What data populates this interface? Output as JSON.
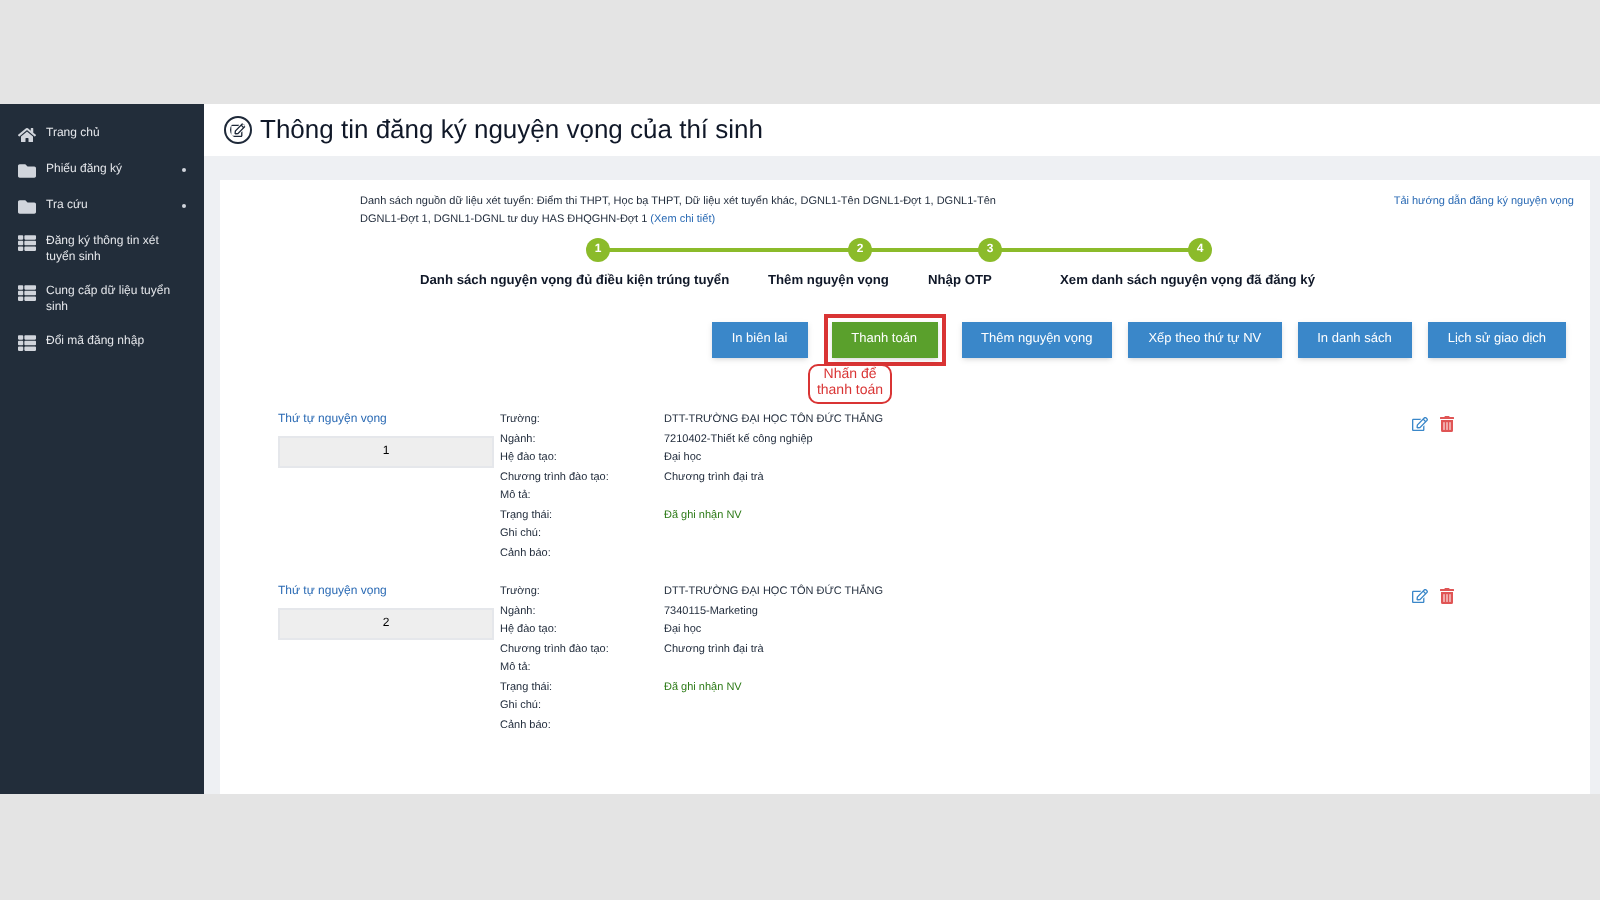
{
  "sidebar": {
    "items": [
      {
        "label": "Trang chủ",
        "kind": "home",
        "expandable": false
      },
      {
        "label": "Phiếu đăng ký",
        "kind": "folder",
        "expandable": true
      },
      {
        "label": "Tra cứu",
        "kind": "folder",
        "expandable": true
      },
      {
        "label": "Đăng ký thông tin xét tuyển sinh",
        "kind": "list",
        "expandable": false
      },
      {
        "label": "Cung cấp dữ liệu tuyển sinh",
        "kind": "list",
        "expandable": false
      },
      {
        "label": "Đổi mã đăng nhập",
        "kind": "list",
        "expandable": false
      }
    ]
  },
  "page_title": "Thông tin đăng ký nguyện vọng của thí sinh",
  "sources": {
    "text": "Danh sách nguồn dữ liệu xét tuyển: Điểm thi THPT, Học bạ THPT, Dữ liệu xét tuyển khác, DGNL1-Tên DGNL1-Đợt 1, DGNL1-Tên DGNL1-Đợt 1, DGNL1-DGNL tư duy HAS ĐHQGHN-Đợt 1",
    "link": "(Xem chi tiết)"
  },
  "guide_link": "Tải hướng dẫn đăng ký nguyện vọng",
  "steps": [
    {
      "number": "1",
      "label": "Danh sách nguyện vọng đủ điều kiện trúng tuyển"
    },
    {
      "number": "2",
      "label": "Thêm nguyện vọng"
    },
    {
      "number": "3",
      "label": "Nhập OTP"
    },
    {
      "number": "4",
      "label": "Xem danh sách nguyện vọng đã đăng ký"
    }
  ],
  "buttons": [
    {
      "label": "In biên lai",
      "kind": "blue",
      "highlighted": false
    },
    {
      "label": "Thanh toán",
      "kind": "green",
      "highlighted": true
    },
    {
      "label": "Thêm nguyện vọng",
      "kind": "blue",
      "highlighted": false
    },
    {
      "label": "Xếp theo thứ tự NV",
      "kind": "blue",
      "highlighted": false
    },
    {
      "label": "In danh sách",
      "kind": "blue",
      "highlighted": false
    },
    {
      "label": "Lịch sử giao dịch",
      "kind": "blue",
      "highlighted": false
    }
  ],
  "callout": "Nhấn để thanh toán",
  "records": [
    {
      "order_label": "Thứ tự nguyện vọng",
      "order": "1",
      "fields": [
        {
          "label": "Trường:",
          "value": "DTT-TRƯỜNG ĐẠI HỌC TÔN ĐỨC THẮNG",
          "kind": "plain"
        },
        {
          "label": "Ngành:",
          "value": "7210402-Thiết kế công nghiệp",
          "kind": "plain"
        },
        {
          "label": "Hệ đào tạo:",
          "value": "Đại học",
          "kind": "plain"
        },
        {
          "label": "Chương trình đào tạo:",
          "value": "Chương trình đại trà",
          "kind": "plain"
        },
        {
          "label": "Mô tả:",
          "kind": "plain"
        },
        {
          "label": "Trạng thái:",
          "value": "Đã ghi nhận NV",
          "kind": "status"
        },
        {
          "label": "Ghi chú:",
          "kind": "plain"
        },
        {
          "label": "Cảnh báo:",
          "kind": "plain"
        }
      ]
    },
    {
      "order_label": "Thứ tự nguyện vọng",
      "order": "2",
      "fields": [
        {
          "label": "Trường:",
          "value": "DTT-TRƯỜNG ĐẠI HỌC TÔN ĐỨC THẮNG",
          "kind": "plain"
        },
        {
          "label": "Ngành:",
          "value": "7340115-Marketing",
          "kind": "plain"
        },
        {
          "label": "Hệ đào tạo:",
          "value": "Đại học",
          "kind": "plain"
        },
        {
          "label": "Chương trình đào tạo:",
          "value": "Chương trình đại trà",
          "kind": "plain"
        },
        {
          "label": "Mô tả:",
          "kind": "plain"
        },
        {
          "label": "Trạng thái:",
          "value": "Đã ghi nhận NV",
          "kind": "status"
        },
        {
          "label": "Ghi chú:",
          "kind": "plain"
        },
        {
          "label": "Cảnh báo:",
          "kind": "plain"
        }
      ]
    }
  ]
}
